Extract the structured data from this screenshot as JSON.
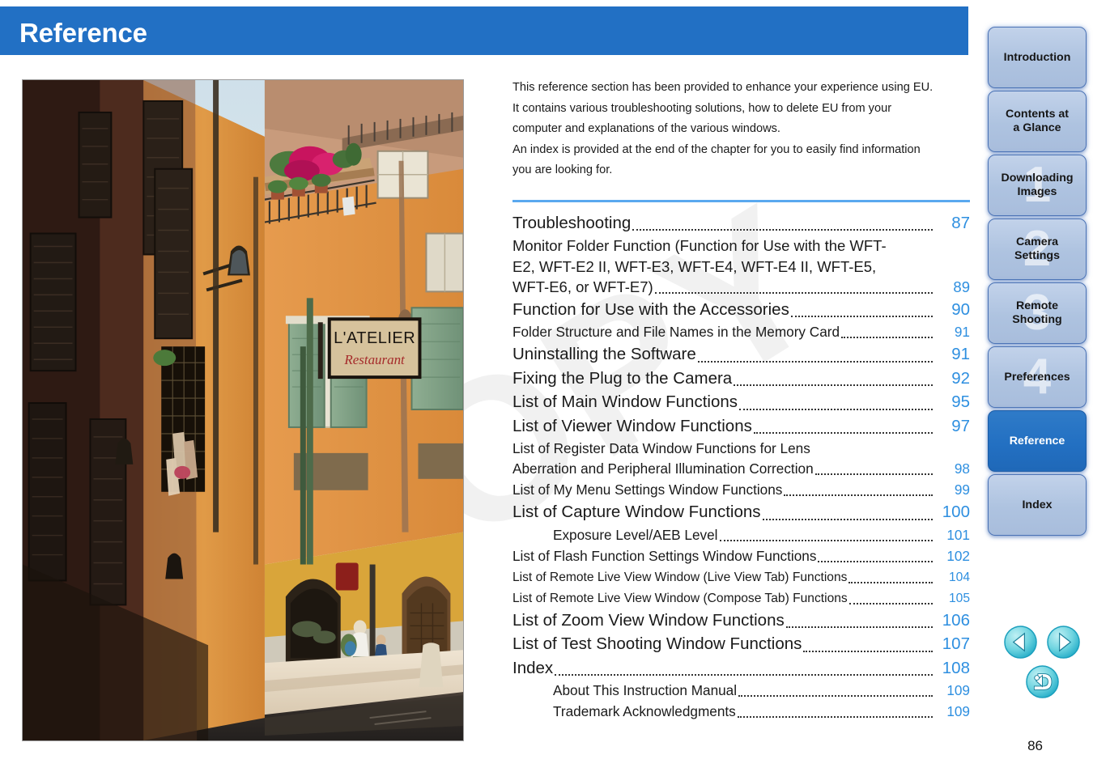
{
  "header": {
    "title": "Reference",
    "banner_color": "#2270c4"
  },
  "intro": {
    "line1": "This reference section has been provided to enhance your experience using EU.",
    "line2": "It contains various troubleshooting solutions, how to delete EU from your",
    "line3": "computer and explanations of the various windows.",
    "line4": "An index is provided at the end of the chapter for you to easily find information",
    "line5": "you are looking for."
  },
  "watermark": {
    "text": "COPY"
  },
  "photo": {
    "sign_primary": "L'ATELIER",
    "sign_secondary": "Restaurant",
    "alt": "Narrow Mediterranean alley with orange and terracotta buildings, green shutters, flower balconies, a restaurant sign, and pedestrians in sunlight at the end of the street"
  },
  "toc": {
    "rule_color": "#5aa9ef",
    "page_color": "#2e8fe0",
    "entries": [
      {
        "label": "Troubleshooting",
        "page": "87",
        "size": "lg",
        "indent": 0,
        "lines": null
      },
      {
        "label": "Monitor Folder Function (Function for Use with the WFT-E2, WFT-E2 II, WFT-E3, WFT-E4, WFT-E4 II, WFT-E5, WFT-E6, or WFT-E7)",
        "page": "89",
        "size": "md",
        "indent": 0,
        "lines": [
          "Monitor Folder Function (Function for Use with the WFT-",
          "E2, WFT-E2 II, WFT-E3, WFT-E4, WFT-E4 II, WFT-E5,",
          "WFT-E6, or WFT-E7)"
        ]
      },
      {
        "label": "Function for Use with the Accessories",
        "page": "90",
        "size": "lg",
        "indent": 0,
        "lines": null
      },
      {
        "label": "Folder Structure and File Names in the Memory Card",
        "page": "91",
        "size": "sub",
        "indent": 0,
        "lines": null
      },
      {
        "label": "Uninstalling the Software",
        "page": "91",
        "size": "lg",
        "indent": 0,
        "lines": null
      },
      {
        "label": "Fixing the Plug to the Camera",
        "page": "92",
        "size": "lg",
        "indent": 0,
        "lines": null
      },
      {
        "label": "List of Main Window Functions",
        "page": "95",
        "size": "lg",
        "indent": 0,
        "lines": null
      },
      {
        "label": "List of Viewer Window Functions",
        "page": "97",
        "size": "lg",
        "indent": 0,
        "lines": null
      },
      {
        "label": "List of Register Data Window Functions for Lens Aberration and Peripheral Illumination Correction",
        "page": "98",
        "size": "sub",
        "indent": 0,
        "lines": [
          "List of Register Data Window Functions for Lens",
          "Aberration and Peripheral Illumination Correction"
        ]
      },
      {
        "label": "List of My Menu Settings Window Functions",
        "page": "99",
        "size": "sub",
        "indent": 0,
        "lines": null
      },
      {
        "label": "List of Capture Window Functions",
        "page": "100",
        "size": "lg",
        "indent": 0,
        "lines": null
      },
      {
        "label": "Exposure Level/AEB Level",
        "page": "101",
        "size": "sub",
        "indent": 1,
        "lines": null
      },
      {
        "label": "List of Flash Function Settings Window Functions",
        "page": "102",
        "size": "sub",
        "indent": 0,
        "lines": null
      },
      {
        "label": "List of Remote Live View Window (Live View Tab) Functions",
        "page": "104",
        "size": "sm",
        "indent": 0,
        "lines": null
      },
      {
        "label": "List of Remote Live View Window (Compose Tab) Functions",
        "page": "105",
        "size": "sm",
        "indent": 0,
        "lines": null
      },
      {
        "label": "List of Zoom View Window Functions",
        "page": "106",
        "size": "lg",
        "indent": 0,
        "lines": null
      },
      {
        "label": "List of Test Shooting Window Functions",
        "page": "107",
        "size": "lg",
        "indent": 0,
        "lines": null
      },
      {
        "label": "Index",
        "page": "108",
        "size": "lg",
        "indent": 0,
        "lines": null
      },
      {
        "label": "About This Instruction Manual",
        "page": "109",
        "size": "sub",
        "indent": 1,
        "lines": null
      },
      {
        "label": "Trademark Acknowledgments",
        "page": "109",
        "size": "sub",
        "indent": 1,
        "lines": null
      }
    ]
  },
  "sidebar": {
    "active_color": "#2370c2",
    "inactive_color": "#aec3e0",
    "tabs": [
      {
        "label": "Introduction",
        "number": "",
        "active": false
      },
      {
        "label": "Contents at\na Glance",
        "number": "",
        "active": false
      },
      {
        "label": "Downloading\nImages",
        "number": "1",
        "active": false
      },
      {
        "label": "Camera\nSettings",
        "number": "2",
        "active": false
      },
      {
        "label": "Remote\nShooting",
        "number": "3",
        "active": false
      },
      {
        "label": "Preferences",
        "number": "4",
        "active": false
      },
      {
        "label": "Reference",
        "number": "",
        "active": true
      },
      {
        "label": "Index",
        "number": "",
        "active": false
      }
    ]
  },
  "nav": {
    "previous_label": "Previous page",
    "next_label": "Next page",
    "return_label": "Return to previous view"
  },
  "footer": {
    "page_number": "86"
  }
}
